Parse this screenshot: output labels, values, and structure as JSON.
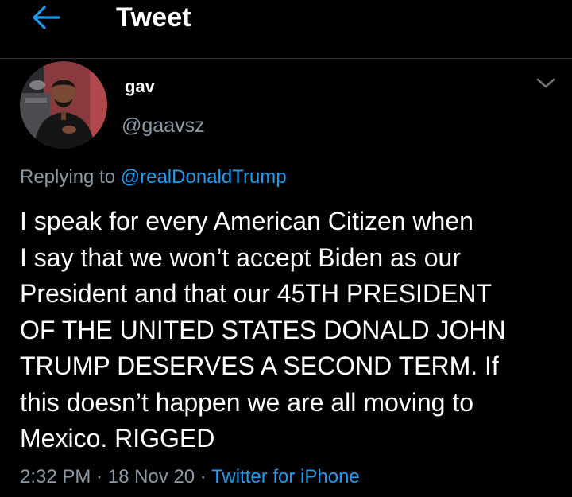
{
  "colors": {
    "background": "#000000",
    "text_primary": "#ffffff",
    "text_secondary": "#8b98a5",
    "accent": "#1d9bf0",
    "divider": "#2f3336"
  },
  "header": {
    "back_icon": "arrow-left-icon",
    "title": "Tweet"
  },
  "author": {
    "display_name": "gav",
    "handle": "@gaavsz",
    "avatar": "profile-photo",
    "menu_icon": "chevron-down-icon"
  },
  "reply_context": {
    "prefix": "Replying to ",
    "mention": "@realDonaldTrump"
  },
  "tweet": {
    "text": "I speak for every American Citizen when\nI say that we won’t accept Biden as our\nPresident and that our 45TH PRESIDENT\nOF THE UNITED STATES DONALD JOHN\nTRUMP DESERVES A SECOND TERM. If\nthis doesn’t happen we are all moving to\nMexico. RIGGED"
  },
  "meta": {
    "time": "2:32 PM",
    "separator": " · ",
    "date": "18 Nov 20",
    "source": "Twitter for iPhone"
  }
}
